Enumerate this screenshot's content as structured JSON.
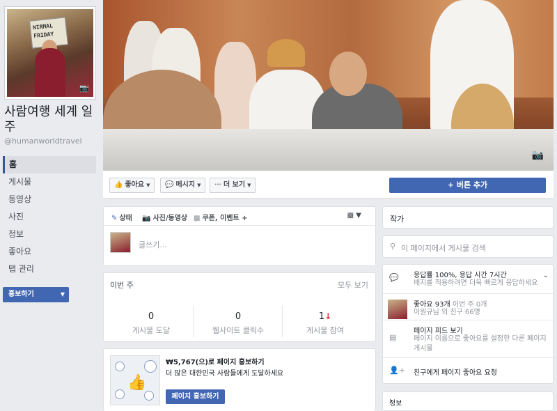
{
  "page": {
    "name": "사람여행 세계 일주",
    "handle": "@humanworldtravel",
    "profile_sign": "NIRMAL FRIDAY"
  },
  "nav": {
    "items": [
      {
        "label": "홈",
        "active": true
      },
      {
        "label": "게시물"
      },
      {
        "label": "동영상"
      },
      {
        "label": "사진"
      },
      {
        "label": "정보"
      },
      {
        "label": "좋아요"
      },
      {
        "label": "탭 관리"
      }
    ],
    "promote_label": "홍보하기"
  },
  "actions": {
    "like": "좋아요",
    "message": "메시지",
    "more": "더 보기",
    "add_button": "버튼 추가"
  },
  "composer": {
    "tab_status": "상태",
    "tab_photo": "사진/동영상",
    "tab_offer": "쿠폰, 이벤트 +",
    "placeholder": "글쓰기..."
  },
  "week": {
    "title": "이번 주",
    "see_all": "모두 보기",
    "stats": [
      {
        "value": "0",
        "label": "게시물 도달"
      },
      {
        "value": "0",
        "label": "웹사이트 클릭수"
      },
      {
        "value": "1",
        "label": "게시물 참여"
      }
    ]
  },
  "promo": {
    "title": "₩5,767(으)로 페이지 홍보하기",
    "subtitle": "더 많은 대한민국 사람들에게 도달하세요",
    "button": "페이지 홍보하기"
  },
  "right": {
    "author": "작가",
    "search_placeholder": "이 페이지에서 게시물 검색",
    "response_title": "응답률 100%, 응답 시간 7시간",
    "response_sub": "배지를 적용하려면 더욱 빠르게 응답하세요",
    "likes_title": "좋아요 93개",
    "likes_this_week": "이번 주 0개",
    "likes_sub": "이원규님 외 친구 66명",
    "feed_title": "페이지 피드 보기",
    "feed_sub": "페이지 이름으로 좋아요를 설정한 다른 페이지 게시물",
    "invite": "친구에게 페이지 좋아요 요청",
    "about": "정보"
  }
}
